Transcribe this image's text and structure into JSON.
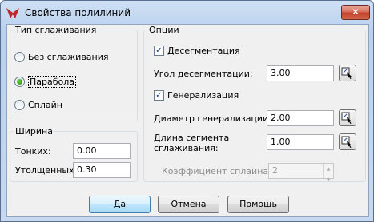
{
  "window": {
    "title": "Свойства полилиний",
    "close_glyph": "✕"
  },
  "smoothing": {
    "legend": "Тип сглаживания",
    "options": [
      {
        "label": "Без сглаживания",
        "selected": false
      },
      {
        "label": "Парабола",
        "selected": true
      },
      {
        "label": "Сплайн",
        "selected": false
      }
    ]
  },
  "width": {
    "legend": "Ширина",
    "thin_label": "Тонких:",
    "thin_value": "0.00",
    "thick_label": "Утолщенных:",
    "thick_value": "0.30"
  },
  "options": {
    "legend": "Опции",
    "desegmentation_label": "Десегментация",
    "desegmentation_checked": true,
    "angle_label": "Угол десегментации:",
    "angle_value": "3.00",
    "generalization_label": "Генерализация",
    "generalization_checked": true,
    "diameter_label": "Диаметр генерализации:",
    "diameter_value": "2.00",
    "segment_label_line1": "Длина сегмента",
    "segment_label_line2": "сглаживания:",
    "segment_value": "1.00",
    "spline_coef_label": "Коэффициент сплайна:",
    "spline_coef_value": "2"
  },
  "buttons": {
    "ok": "Да",
    "cancel": "Отмена",
    "help": "Помощь"
  },
  "glyphs": {
    "check": "✓",
    "spin_up": "▲",
    "spin_down": "▼"
  },
  "icons": {
    "app": "app-logo-icon",
    "pick": "pick-from-map-icon"
  }
}
